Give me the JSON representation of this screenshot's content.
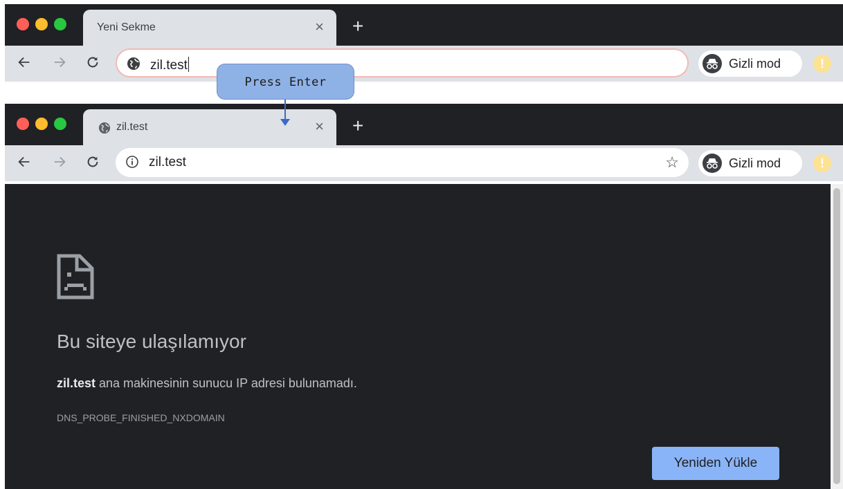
{
  "annotation": {
    "label": "Press Enter"
  },
  "before": {
    "tab": {
      "title": "Yeni Sekme",
      "close": "×"
    },
    "new_tab": "+",
    "omnibox": {
      "value": "zil.test",
      "icon": "globe-icon"
    },
    "incognito": {
      "label": "Gizli mod",
      "icon": "incognito-icon"
    },
    "warning": "!"
  },
  "after": {
    "tab": {
      "title": "zil.test",
      "close": "×",
      "favicon": "globe-icon"
    },
    "new_tab": "+",
    "omnibox": {
      "value": "zil.test",
      "icon": "info-icon"
    },
    "incognito": {
      "label": "Gizli mod",
      "icon": "incognito-icon"
    },
    "warning": "!",
    "bookmark": "☆",
    "error": {
      "title": "Bu siteye ulaşılamıyor",
      "host": "zil.test",
      "description": " ana makinesinin sunucu IP adresi bulunamadı.",
      "code": "DNS_PROBE_FINISHED_NXDOMAIN",
      "reload_label": "Yeniden Yükle"
    }
  },
  "colors": {
    "tabstrip": "#202124",
    "toolbar": "#dee1e6",
    "page_bg": "#202124",
    "button_blue": "#8ab4f8",
    "callout": "#8fb2e6"
  }
}
